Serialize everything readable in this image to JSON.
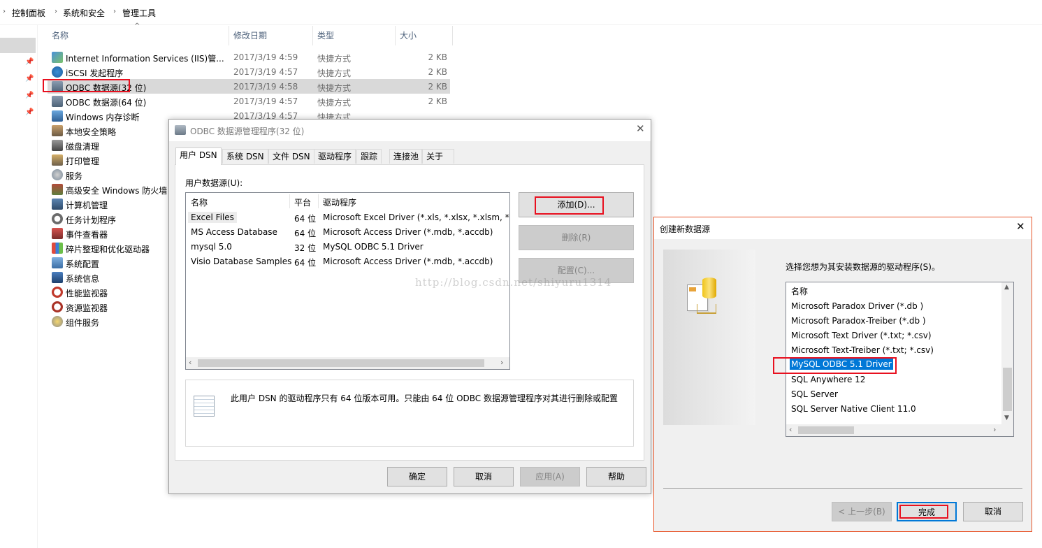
{
  "explorer": {
    "breadcrumb": [
      "控制面板",
      "系统和安全",
      "管理工具"
    ],
    "columns": {
      "name": "名称",
      "date": "修改日期",
      "type": "类型",
      "size": "大小"
    },
    "files": [
      {
        "name": "Internet Information Services (IIS)管...",
        "date": "2017/3/19 4:59",
        "type": "快捷方式",
        "size": "2 KB",
        "icon": "iis-icon"
      },
      {
        "name": "iSCSI 发起程序",
        "date": "2017/3/19 4:57",
        "type": "快捷方式",
        "size": "2 KB",
        "icon": "iscsi-icon"
      },
      {
        "name": "ODBC 数据源(32 位)",
        "date": "2017/3/19 4:58",
        "type": "快捷方式",
        "size": "2 KB",
        "icon": "odbc-icon"
      },
      {
        "name": "ODBC 数据源(64 位)",
        "date": "2017/3/19 4:57",
        "type": "快捷方式",
        "size": "2 KB",
        "icon": "odbc-icon"
      },
      {
        "name": "Windows 内存诊断",
        "date": "2017/3/19 4:57",
        "type": "快捷方式",
        "size": "",
        "icon": "memory-diagnostic-icon"
      },
      {
        "name": "本地安全策略",
        "icon": "security-policy-icon"
      },
      {
        "name": "磁盘清理",
        "icon": "disk-cleanup-icon"
      },
      {
        "name": "打印管理",
        "icon": "print-management-icon"
      },
      {
        "name": "服务",
        "icon": "services-icon"
      },
      {
        "name": "高级安全 Windows 防火墙",
        "icon": "firewall-icon"
      },
      {
        "name": "计算机管理",
        "icon": "computer-management-icon"
      },
      {
        "name": "任务计划程序",
        "icon": "task-scheduler-icon"
      },
      {
        "name": "事件查看器",
        "icon": "event-viewer-icon"
      },
      {
        "name": "碎片整理和优化驱动器",
        "icon": "defrag-icon"
      },
      {
        "name": "系统配置",
        "icon": "system-config-icon"
      },
      {
        "name": "系统信息",
        "icon": "system-info-icon"
      },
      {
        "name": "性能监视器",
        "icon": "performance-monitor-icon"
      },
      {
        "name": "资源监视器",
        "icon": "resource-monitor-icon"
      },
      {
        "name": "组件服务",
        "icon": "component-services-icon"
      }
    ]
  },
  "odbc_dialog": {
    "title": "ODBC 数据源管理程序(32 位)",
    "tabs": [
      "用户 DSN",
      "系统 DSN",
      "文件 DSN",
      "驱动程序",
      "跟踪",
      "连接池",
      "关于"
    ],
    "list_label": "用户数据源(U):",
    "list_headers": {
      "name": "名称",
      "platform": "平台",
      "driver": "驱动程序"
    },
    "rows": [
      {
        "name": "Excel Files",
        "platform": "64 位",
        "driver": "Microsoft Excel Driver (*.xls, *.xlsx, *.xlsm, *.xls"
      },
      {
        "name": "MS Access Database",
        "platform": "64 位",
        "driver": "Microsoft Access Driver (*.mdb, *.accdb)"
      },
      {
        "name": "mysql 5.0",
        "platform": "32 位",
        "driver": "MySQL ODBC 5.1 Driver"
      },
      {
        "name": "Visio Database Samples",
        "platform": "64 位",
        "driver": "Microsoft Access Driver (*.mdb, *.accdb)"
      }
    ],
    "buttons": {
      "add": "添加(D)...",
      "remove": "删除(R)",
      "configure": "配置(C)..."
    },
    "info_text": "此用户 DSN 的驱动程序只有 64 位版本可用。只能由 64 位 ODBC 数据源管理程序对其进行删除或配置",
    "footer": {
      "ok": "确定",
      "cancel": "取消",
      "apply": "应用(A)",
      "help": "帮助"
    },
    "watermark": "http://blog.csdn.net/shiyuru1314"
  },
  "new_ds_dialog": {
    "title": "创建新数据源",
    "prompt": "选择您想为其安装数据源的驱动程序(S)。",
    "list_header": "名称",
    "drivers": [
      "Microsoft Paradox Driver (*.db )",
      "Microsoft Paradox-Treiber (*.db )",
      "Microsoft Text Driver (*.txt; *.csv)",
      "Microsoft Text-Treiber (*.txt; *.csv)",
      "MySQL ODBC 5.1 Driver",
      "SQL Anywhere 12",
      "SQL Server",
      "SQL Server Native Client 11.0"
    ],
    "selected_driver": "MySQL ODBC 5.1 Driver",
    "buttons": {
      "back": "< 上一步(B)",
      "finish": "完成",
      "cancel": "取消"
    }
  },
  "colors": {
    "highlight_red": "#e8101f",
    "selection_blue": "#0078d7",
    "dialog_bg": "#f0f0f0"
  }
}
